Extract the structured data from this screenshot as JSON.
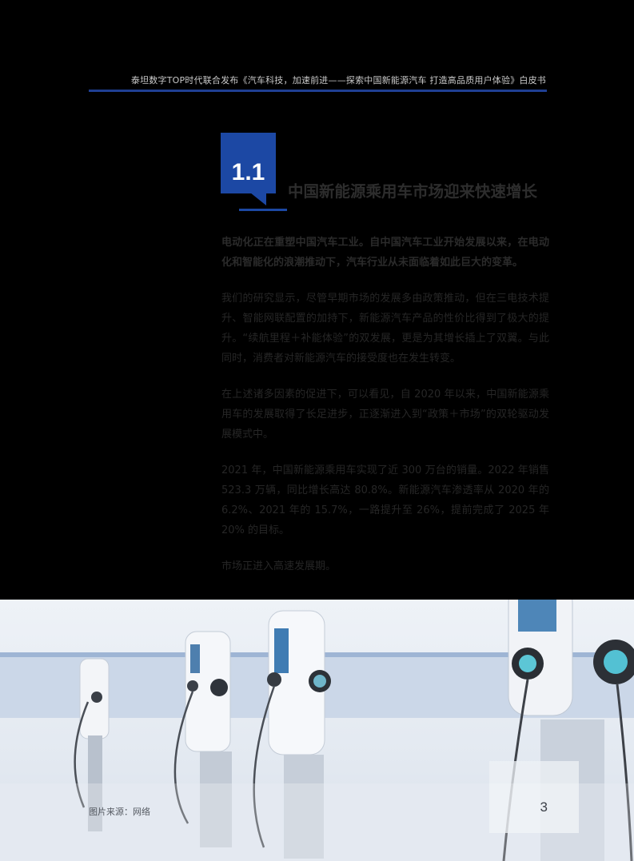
{
  "header": {
    "title": "泰坦数字TOP时代联合发布《汽车科技，加速前进——探索中国新能源汽车 打造高品质用户体验》白皮书"
  },
  "section": {
    "number": "1.1",
    "title": "中国新能源乘用车市场迎来快速增长"
  },
  "paragraphs": [
    "电动化正在重塑中国汽车工业。自中国汽车工业开始发展以来，在电动化和智能化的浪潮推动下，汽车行业从未面临着如此巨大的变革。",
    "我们的研究显示，尽管早期市场的发展多由政策推动，但在三电技术提升、智能网联配置的加持下，新能源汽车产品的性价比得到了极大的提升。“续航里程＋补能体验”的双发展，更是为其增长插上了双翼。与此同时，消费者对新能源汽车的接受度也在发生转变。",
    "在上述诸多因素的促进下，可以看见，自 2020 年以来，中国新能源乘用车的发展取得了长足进步，正逐渐进入到“政策＋市场”的双轮驱动发展模式中。",
    "2021 年，中国新能源乘用车实现了近 300 万台的销量。2022 年销售 523.3 万辆，同比增长高达 80.8%。新能源汽车渗透率从 2020 年的 6.2%、2021 年的 15.7%，一路提升至 26%，提前完成了 2025 年 20% 的目标。",
    "市场正进入高速发展期。"
  ],
  "footer": {
    "caption": "图片来源：网络",
    "page_number": "3"
  },
  "colors": {
    "accent": "#1c48a4",
    "background": "#000000"
  }
}
